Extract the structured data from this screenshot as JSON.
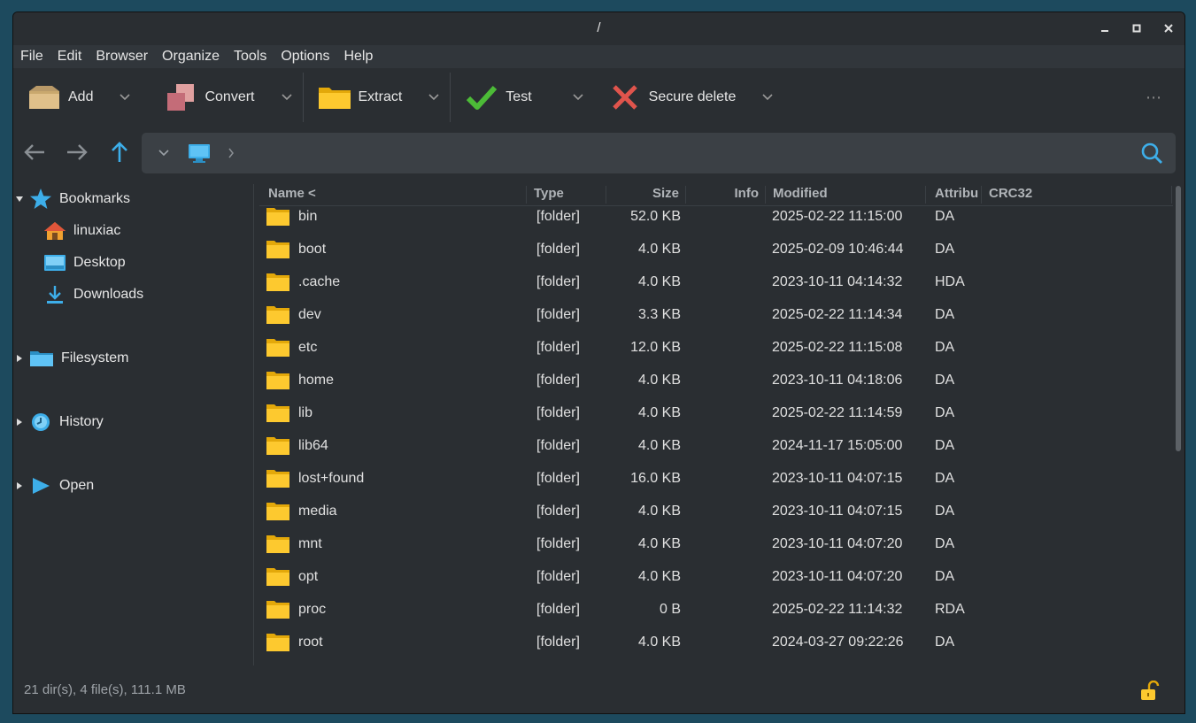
{
  "window": {
    "title": "/"
  },
  "menu": [
    "File",
    "Edit",
    "Browser",
    "Organize",
    "Tools",
    "Options",
    "Help"
  ],
  "toolbar": {
    "add": "Add",
    "convert": "Convert",
    "extract": "Extract",
    "test": "Test",
    "secure_delete": "Secure delete",
    "more": "⋯"
  },
  "sidebar": {
    "bookmarks": {
      "label": "Bookmarks",
      "items": [
        "linuxiac",
        "Desktop",
        "Downloads"
      ]
    },
    "filesystem": "Filesystem",
    "history": "History",
    "open": "Open"
  },
  "columns": [
    "Name <",
    "Type",
    "Size",
    "Info",
    "Modified",
    "Attribu",
    "CRC32"
  ],
  "files": [
    {
      "name": "bin",
      "type": "[folder]",
      "size": "52.0 KB",
      "modified": "2025-02-22 11:15:00",
      "attr": "DA"
    },
    {
      "name": "boot",
      "type": "[folder]",
      "size": "4.0 KB",
      "modified": "2025-02-09 10:46:44",
      "attr": "DA"
    },
    {
      "name": ".cache",
      "type": "[folder]",
      "size": "4.0 KB",
      "modified": "2023-10-11 04:14:32",
      "attr": "HDA"
    },
    {
      "name": "dev",
      "type": "[folder]",
      "size": "3.3 KB",
      "modified": "2025-02-22 11:14:34",
      "attr": "DA"
    },
    {
      "name": "etc",
      "type": "[folder]",
      "size": "12.0 KB",
      "modified": "2025-02-22 11:15:08",
      "attr": "DA"
    },
    {
      "name": "home",
      "type": "[folder]",
      "size": "4.0 KB",
      "modified": "2023-10-11 04:18:06",
      "attr": "DA"
    },
    {
      "name": "lib",
      "type": "[folder]",
      "size": "4.0 KB",
      "modified": "2025-02-22 11:14:59",
      "attr": "DA"
    },
    {
      "name": "lib64",
      "type": "[folder]",
      "size": "4.0 KB",
      "modified": "2024-11-17 15:05:00",
      "attr": "DA"
    },
    {
      "name": "lost+found",
      "type": "[folder]",
      "size": "16.0 KB",
      "modified": "2023-10-11 04:07:15",
      "attr": "DA"
    },
    {
      "name": "media",
      "type": "[folder]",
      "size": "4.0 KB",
      "modified": "2023-10-11 04:07:15",
      "attr": "DA"
    },
    {
      "name": "mnt",
      "type": "[folder]",
      "size": "4.0 KB",
      "modified": "2023-10-11 04:07:20",
      "attr": "DA"
    },
    {
      "name": "opt",
      "type": "[folder]",
      "size": "4.0 KB",
      "modified": "2023-10-11 04:07:20",
      "attr": "DA"
    },
    {
      "name": "proc",
      "type": "[folder]",
      "size": "0 B",
      "modified": "2025-02-22 11:14:32",
      "attr": "RDA"
    },
    {
      "name": "root",
      "type": "[folder]",
      "size": "4.0 KB",
      "modified": "2024-03-27 09:22:26",
      "attr": "DA"
    }
  ],
  "status": {
    "summary": "21 dir(s), 4 file(s), 111.1 MB"
  },
  "colors": {
    "accent": "#3daee9",
    "folder": "#fdc92f",
    "window_bg": "#2a2e32",
    "desktop_bg": "#1d4a5e"
  }
}
